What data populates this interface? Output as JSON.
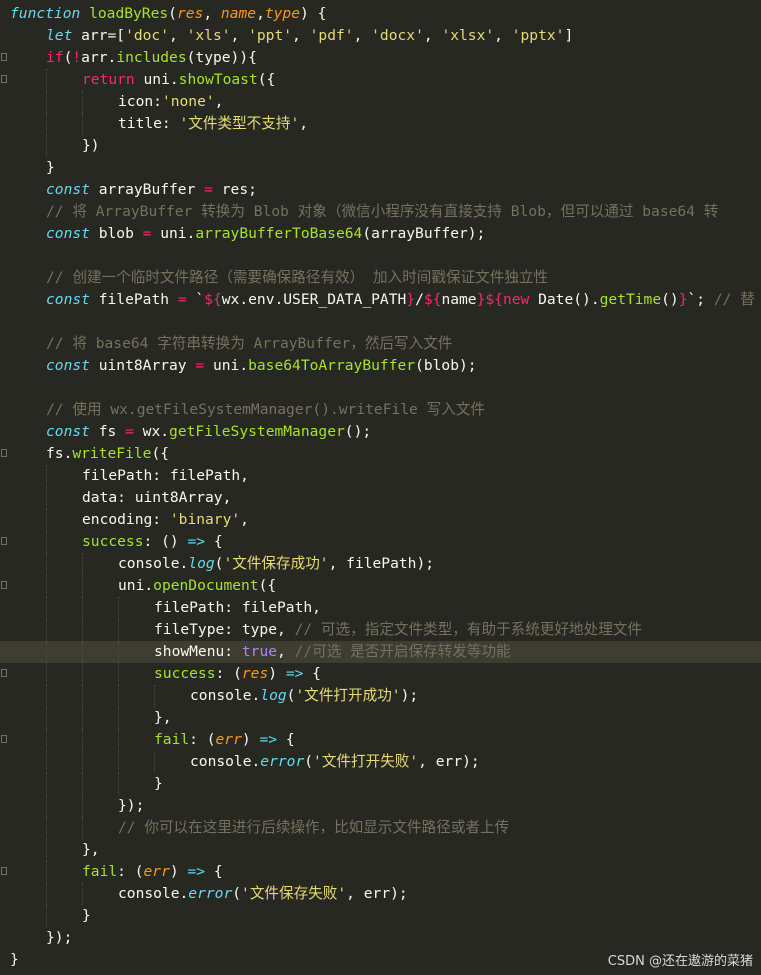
{
  "editor": {
    "lines": [
      {
        "indent": 0,
        "fold": false,
        "tokens": [
          {
            "c": "fn",
            "v": "function"
          },
          {
            "v": " "
          },
          {
            "c": "f",
            "v": "loadByRes"
          },
          {
            "v": "("
          },
          {
            "c": "p",
            "v": "res"
          },
          {
            "v": ", "
          },
          {
            "c": "p",
            "v": "name"
          },
          {
            "v": ","
          },
          {
            "c": "p",
            "v": "type"
          },
          {
            "v": ") {"
          }
        ]
      },
      {
        "indent": 1,
        "fold": false,
        "tokens": [
          {
            "c": "t",
            "v": "let"
          },
          {
            "v": " arr=["
          },
          {
            "c": "s",
            "v": "'doc'"
          },
          {
            "v": ", "
          },
          {
            "c": "s",
            "v": "'xls'"
          },
          {
            "v": ", "
          },
          {
            "c": "s",
            "v": "'ppt'"
          },
          {
            "v": ", "
          },
          {
            "c": "s",
            "v": "'pdf'"
          },
          {
            "v": ", "
          },
          {
            "c": "s",
            "v": "'docx'"
          },
          {
            "v": ", "
          },
          {
            "c": "s",
            "v": "'xlsx'"
          },
          {
            "v": ", "
          },
          {
            "c": "s",
            "v": "'pptx'"
          },
          {
            "v": "]"
          }
        ]
      },
      {
        "indent": 1,
        "fold": true,
        "tokens": [
          {
            "c": "k",
            "v": "if"
          },
          {
            "v": "("
          },
          {
            "c": "k",
            "v": "!"
          },
          {
            "v": "arr."
          },
          {
            "c": "f",
            "v": "includes"
          },
          {
            "v": "(type)){"
          }
        ]
      },
      {
        "indent": 2,
        "fold": true,
        "tokens": [
          {
            "c": "k",
            "v": "return"
          },
          {
            "v": " uni."
          },
          {
            "c": "f",
            "v": "showToast"
          },
          {
            "v": "({"
          }
        ]
      },
      {
        "indent": 3,
        "fold": false,
        "tokens": [
          {
            "v": "icon:"
          },
          {
            "c": "s",
            "v": "'none'"
          },
          {
            "v": ","
          }
        ]
      },
      {
        "indent": 3,
        "fold": false,
        "tokens": [
          {
            "v": "title: "
          },
          {
            "c": "s",
            "v": "'文件类型不支持'"
          },
          {
            "v": ","
          }
        ]
      },
      {
        "indent": 2,
        "fold": false,
        "tokens": [
          {
            "v": "})"
          }
        ]
      },
      {
        "indent": 1,
        "fold": false,
        "tokens": [
          {
            "v": "}"
          }
        ]
      },
      {
        "indent": 1,
        "fold": false,
        "tokens": [
          {
            "c": "t",
            "v": "const"
          },
          {
            "v": " arrayBuffer "
          },
          {
            "c": "k",
            "v": "="
          },
          {
            "v": " res;"
          }
        ]
      },
      {
        "indent": 1,
        "fold": false,
        "tokens": [
          {
            "c": "c",
            "v": "// 将 ArrayBuffer 转换为 Blob 对象（微信小程序没有直接支持 Blob，但可以通过 base64 转"
          }
        ]
      },
      {
        "indent": 1,
        "fold": false,
        "tokens": [
          {
            "c": "t",
            "v": "const"
          },
          {
            "v": " blob "
          },
          {
            "c": "k",
            "v": "="
          },
          {
            "v": " uni."
          },
          {
            "c": "f",
            "v": "arrayBufferToBase64"
          },
          {
            "v": "(arrayBuffer);"
          }
        ]
      },
      {
        "indent": 0,
        "fold": false,
        "tokens": []
      },
      {
        "indent": 1,
        "fold": false,
        "tokens": [
          {
            "c": "c",
            "v": "// 创建一个临时文件路径（需要确保路径有效） 加入时间戳保证文件独立性"
          }
        ]
      },
      {
        "indent": 1,
        "fold": false,
        "tokens": [
          {
            "c": "t",
            "v": "const"
          },
          {
            "v": " filePath "
          },
          {
            "c": "k",
            "v": "="
          },
          {
            "v": " `"
          },
          {
            "c": "k",
            "v": "${"
          },
          {
            "v": "wx.env.USER_DATA_PATH"
          },
          {
            "c": "k",
            "v": "}"
          },
          {
            "v": "/"
          },
          {
            "c": "k",
            "v": "${"
          },
          {
            "v": "name"
          },
          {
            "c": "k",
            "v": "}${"
          },
          {
            "c": "k",
            "v": "new"
          },
          {
            "v": " Date()."
          },
          {
            "c": "f",
            "v": "getTime"
          },
          {
            "v": "()"
          },
          {
            "c": "k",
            "v": "}"
          },
          {
            "v": "`; "
          },
          {
            "c": "c",
            "v": "// 替"
          }
        ]
      },
      {
        "indent": 0,
        "fold": false,
        "tokens": []
      },
      {
        "indent": 1,
        "fold": false,
        "tokens": [
          {
            "c": "c",
            "v": "// 将 base64 字符串转换为 ArrayBuffer，然后写入文件"
          }
        ]
      },
      {
        "indent": 1,
        "fold": false,
        "tokens": [
          {
            "c": "t",
            "v": "const"
          },
          {
            "v": " uint8Array "
          },
          {
            "c": "k",
            "v": "="
          },
          {
            "v": " uni."
          },
          {
            "c": "f",
            "v": "base64ToArrayBuffer"
          },
          {
            "v": "(blob);"
          }
        ]
      },
      {
        "indent": 0,
        "fold": false,
        "tokens": []
      },
      {
        "indent": 1,
        "fold": false,
        "tokens": [
          {
            "c": "c",
            "v": "// 使用 wx.getFileSystemManager().writeFile 写入文件"
          }
        ]
      },
      {
        "indent": 1,
        "fold": false,
        "tokens": [
          {
            "c": "t",
            "v": "const"
          },
          {
            "v": " fs "
          },
          {
            "c": "k",
            "v": "="
          },
          {
            "v": " wx."
          },
          {
            "c": "f",
            "v": "getFileSystemManager"
          },
          {
            "v": "();"
          }
        ]
      },
      {
        "indent": 1,
        "fold": true,
        "tokens": [
          {
            "v": "fs."
          },
          {
            "c": "f",
            "v": "writeFile"
          },
          {
            "v": "({"
          }
        ]
      },
      {
        "indent": 2,
        "fold": false,
        "tokens": [
          {
            "v": "filePath: filePath,"
          }
        ]
      },
      {
        "indent": 2,
        "fold": false,
        "tokens": [
          {
            "v": "data: uint8Array,"
          }
        ]
      },
      {
        "indent": 2,
        "fold": false,
        "tokens": [
          {
            "v": "encoding: "
          },
          {
            "c": "s",
            "v": "'binary'"
          },
          {
            "v": ","
          }
        ]
      },
      {
        "indent": 2,
        "fold": true,
        "tokens": [
          {
            "c": "f",
            "v": "success"
          },
          {
            "v": ": () "
          },
          {
            "c": "t",
            "v": "=>"
          },
          {
            "v": " {"
          }
        ]
      },
      {
        "indent": 3,
        "fold": false,
        "tokens": [
          {
            "v": "console."
          },
          {
            "c": "fn",
            "v": "log"
          },
          {
            "v": "("
          },
          {
            "c": "s",
            "v": "'文件保存成功'"
          },
          {
            "v": ", filePath);"
          }
        ]
      },
      {
        "indent": 3,
        "fold": true,
        "tokens": [
          {
            "v": "uni."
          },
          {
            "c": "f",
            "v": "openDocument"
          },
          {
            "v": "({"
          }
        ]
      },
      {
        "indent": 4,
        "fold": false,
        "tokens": [
          {
            "v": "filePath: filePath,"
          }
        ]
      },
      {
        "indent": 4,
        "fold": false,
        "tokens": [
          {
            "v": "fileType: type, "
          },
          {
            "c": "c",
            "v": "// 可选，指定文件类型，有助于系统更好地处理文件"
          }
        ]
      },
      {
        "indent": 4,
        "fold": false,
        "hl": true,
        "tokens": [
          {
            "v": "showMenu: "
          },
          {
            "c": "n",
            "v": "true"
          },
          {
            "v": ", "
          },
          {
            "c": "c",
            "v": "//可选 是否开启保存转发等功能"
          }
        ]
      },
      {
        "indent": 4,
        "fold": true,
        "tokens": [
          {
            "c": "f",
            "v": "success"
          },
          {
            "v": ": ("
          },
          {
            "c": "p",
            "v": "res"
          },
          {
            "v": ") "
          },
          {
            "c": "t",
            "v": "=>"
          },
          {
            "v": " {"
          }
        ]
      },
      {
        "indent": 5,
        "fold": false,
        "tokens": [
          {
            "v": "console."
          },
          {
            "c": "fn",
            "v": "log"
          },
          {
            "v": "("
          },
          {
            "c": "s",
            "v": "'文件打开成功'"
          },
          {
            "v": ");"
          }
        ]
      },
      {
        "indent": 4,
        "fold": false,
        "tokens": [
          {
            "v": "},"
          }
        ]
      },
      {
        "indent": 4,
        "fold": true,
        "tokens": [
          {
            "c": "f",
            "v": "fail"
          },
          {
            "v": ": ("
          },
          {
            "c": "p",
            "v": "err"
          },
          {
            "v": ") "
          },
          {
            "c": "t",
            "v": "=>"
          },
          {
            "v": " {"
          }
        ]
      },
      {
        "indent": 5,
        "fold": false,
        "tokens": [
          {
            "v": "console."
          },
          {
            "c": "fn",
            "v": "error"
          },
          {
            "v": "("
          },
          {
            "c": "s",
            "v": "'文件打开失败'"
          },
          {
            "v": ", err);"
          }
        ]
      },
      {
        "indent": 4,
        "fold": false,
        "tokens": [
          {
            "v": "}"
          }
        ]
      },
      {
        "indent": 3,
        "fold": false,
        "tokens": [
          {
            "v": "});"
          }
        ]
      },
      {
        "indent": 3,
        "fold": false,
        "tokens": [
          {
            "c": "c",
            "v": "// 你可以在这里进行后续操作，比如显示文件路径或者上传"
          }
        ]
      },
      {
        "indent": 2,
        "fold": false,
        "tokens": [
          {
            "v": "},"
          }
        ]
      },
      {
        "indent": 2,
        "fold": true,
        "tokens": [
          {
            "c": "f",
            "v": "fail"
          },
          {
            "v": ": ("
          },
          {
            "c": "p",
            "v": "err"
          },
          {
            "v": ") "
          },
          {
            "c": "t",
            "v": "=>"
          },
          {
            "v": " {"
          }
        ]
      },
      {
        "indent": 3,
        "fold": false,
        "tokens": [
          {
            "v": "console."
          },
          {
            "c": "fn",
            "v": "error"
          },
          {
            "v": "("
          },
          {
            "c": "s",
            "v": "'文件保存失败'"
          },
          {
            "v": ", err);"
          }
        ]
      },
      {
        "indent": 2,
        "fold": false,
        "tokens": [
          {
            "v": "}"
          }
        ]
      },
      {
        "indent": 1,
        "fold": false,
        "tokens": [
          {
            "v": "});"
          }
        ]
      },
      {
        "indent": 0,
        "fold": false,
        "tokens": [
          {
            "v": "}"
          }
        ]
      }
    ]
  },
  "watermark": "CSDN @还在遨游的菜猪"
}
